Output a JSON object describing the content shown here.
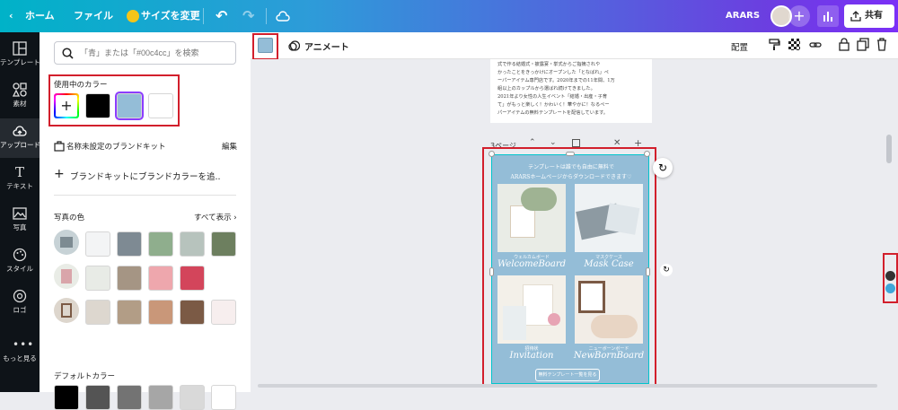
{
  "topbar": {
    "home": "ホーム",
    "file": "ファイル",
    "resize": "サイズを変更",
    "team": "ARARS",
    "share": "共有"
  },
  "search": {
    "placeholder": "「青」または「#00c4cc」を検索"
  },
  "panel": {
    "in_use_title": "使用中のカラー",
    "brand_kit": "名称未設定のブランドキット",
    "edit": "編集",
    "add_brand": "ブランドキットにブランドカラーを追..",
    "photo_colors": "写真の色",
    "show_all": "すべて表示",
    "default_colors": "デフォルトカラー"
  },
  "rail": {
    "items": [
      "テンプレート",
      "素材",
      "アップロード",
      "テキスト",
      "写真",
      "スタイル",
      "ロゴ",
      "もっと見る"
    ]
  },
  "toolbar": {
    "animate": "アニメート",
    "arrange": "配置"
  },
  "colors": {
    "in_use": [
      "#000000",
      "#94bdd7",
      "#ffffff"
    ],
    "photo_rows": [
      [
        "#f3f4f5",
        "#7e8a93",
        "#8fae8d",
        "#b7c3bd",
        "#6d7f5f"
      ],
      [
        "#e8ebe6",
        "#a59584",
        "#eea7ad",
        "#d3455b"
      ],
      [
        "#ddd7cf",
        "#b29d86",
        "#c99779",
        "#7b5a45",
        "#f7eeee"
      ]
    ],
    "default": [
      "#000000",
      "#545454",
      "#737373",
      "#a6a6a6",
      "#d9d9d9",
      "#ffffff"
    ],
    "accent_red": "#d21f2c",
    "design_bg": "#94bdd7"
  },
  "page_above": {
    "lines": [
      "式で作る結婚式・披露宴・挙式からご指摘されや",
      "かったことをきっかけにオープンした「となばれ」ペ",
      "ーパーアイテム専門店です。2020年までの11年間、1万",
      "組以上のカップルから選ばれ続けてきました。",
      "2021年より女性の人生イベント「結婚・出産・子育",
      "て」がもっと楽しく！かわいく！華やかに！なるペー",
      "パーアイテムの無料テンプレートを配信しています。"
    ]
  },
  "page": {
    "label": "3ページ"
  },
  "design": {
    "header1": "テンプレートは誰でも自由に無料で",
    "header2": "ARARSホームページからダウンロードできます♡",
    "items": [
      {
        "jp": "ウェルカムボード",
        "en": "WelcomeBoard"
      },
      {
        "jp": "マスクケース",
        "en": "Mask Case"
      },
      {
        "jp": "招待状",
        "en": "Invitation"
      },
      {
        "jp": "ニューボーンボード",
        "en": "NewBornBoard"
      }
    ],
    "button": "無料テンプレート一覧を見る"
  }
}
